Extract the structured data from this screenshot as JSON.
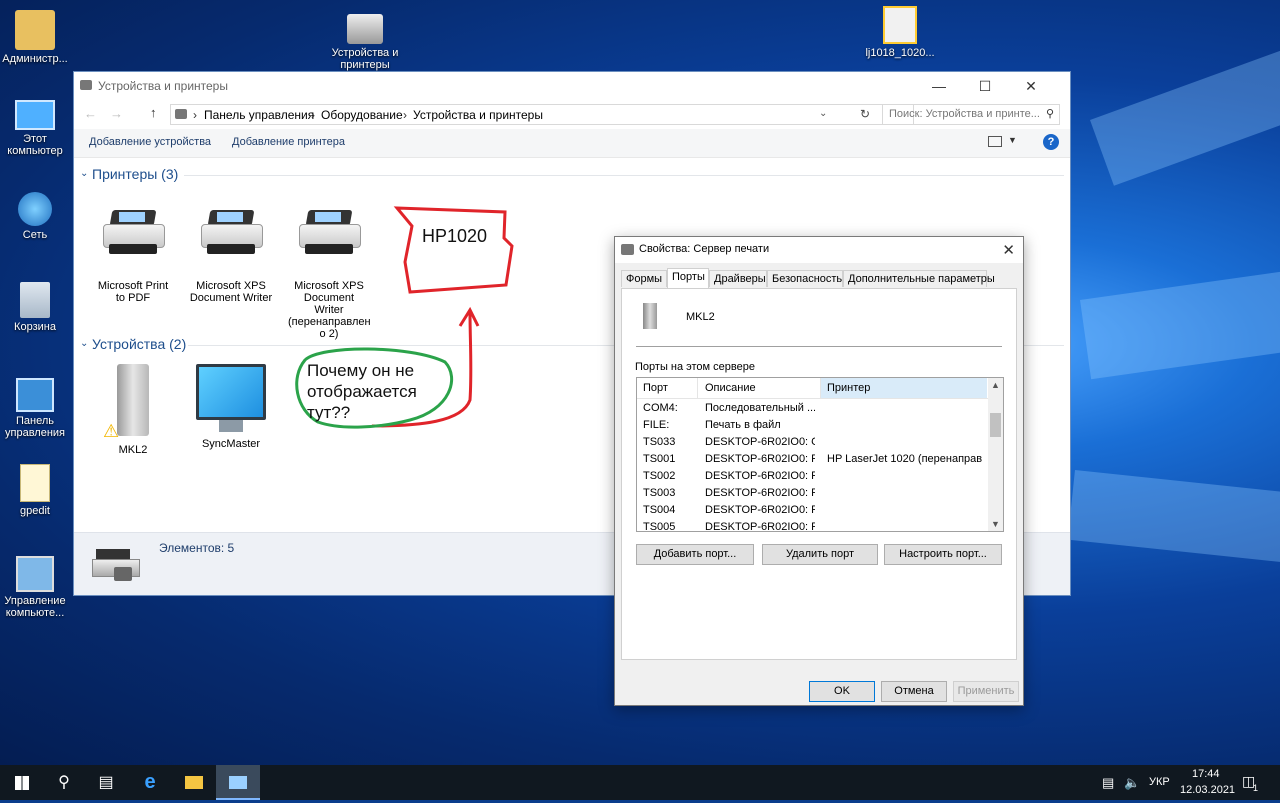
{
  "desktop": {
    "icons": [
      {
        "label": "Администр..."
      },
      {
        "label": "Этот компьютер"
      },
      {
        "label": "Сеть"
      },
      {
        "label": "Корзина"
      },
      {
        "label": "Панель управления"
      },
      {
        "label": "gpedit"
      },
      {
        "label": "Управление компьюте..."
      },
      {
        "label": "Устройства и принтеры"
      },
      {
        "label": "lj1018_1020..."
      }
    ]
  },
  "explorer": {
    "title": "Устройства и принтеры",
    "breadcrumb": [
      "Панель управления",
      "Оборудование",
      "Устройства и принтеры"
    ],
    "search_placeholder": "Поиск: Устройства и принте...",
    "commands": {
      "add_device": "Добавление устройства",
      "add_printer": "Добавление принтера"
    },
    "printers_group": "Принтеры (3)",
    "printers": [
      {
        "name": "Microsoft Print to PDF"
      },
      {
        "name": "Microsoft XPS Document Writer"
      },
      {
        "name": "Microsoft XPS Document Writer (перенаправлен о 2)"
      }
    ],
    "devices_group": "Устройства (2)",
    "devices": [
      {
        "name": "MKL2"
      },
      {
        "name": "SyncMaster"
      }
    ],
    "status": "Элементов: 5"
  },
  "annotations": {
    "box_text": "HP1020",
    "bubble_text": "Почему он не отображается тут??"
  },
  "dialog": {
    "title": "Свойства: Сервер печати",
    "tabs": [
      "Формы",
      "Порты",
      "Драйверы",
      "Безопасность",
      "Дополнительные параметры"
    ],
    "active_tab": "Порты",
    "server_name": "MKL2",
    "ports_label": "Порты на этом сервере",
    "columns": [
      "Порт",
      "Описание",
      "Принтер"
    ],
    "rows": [
      {
        "port": "COM4:",
        "desc": "Последовательный ...",
        "printer": ""
      },
      {
        "port": "FILE:",
        "desc": "Печать в файл",
        "printer": ""
      },
      {
        "port": "TS033",
        "desc": "DESKTOP-6R02IO0: C...",
        "printer": ""
      },
      {
        "port": "TS001",
        "desc": "DESKTOP-6R02IO0: P...",
        "printer": "HP LaserJet 1020 (перенаправ..."
      },
      {
        "port": "TS002",
        "desc": "DESKTOP-6R02IO0: P...",
        "printer": ""
      },
      {
        "port": "TS003",
        "desc": "DESKTOP-6R02IO0: P...",
        "printer": ""
      },
      {
        "port": "TS004",
        "desc": "DESKTOP-6R02IO0: P...",
        "printer": ""
      },
      {
        "port": "TS005",
        "desc": "DESKTOP-6R02IO0: P...",
        "printer": ""
      }
    ],
    "buttons": {
      "add_port": "Добавить порт...",
      "delete_port": "Удалить порт",
      "configure_port": "Настроить порт...",
      "ok": "OK",
      "cancel": "Отмена",
      "apply": "Применить"
    }
  },
  "taskbar": {
    "lang": "УКР",
    "time": "17:44",
    "date": "12.03.2021",
    "notif_count": "1"
  }
}
